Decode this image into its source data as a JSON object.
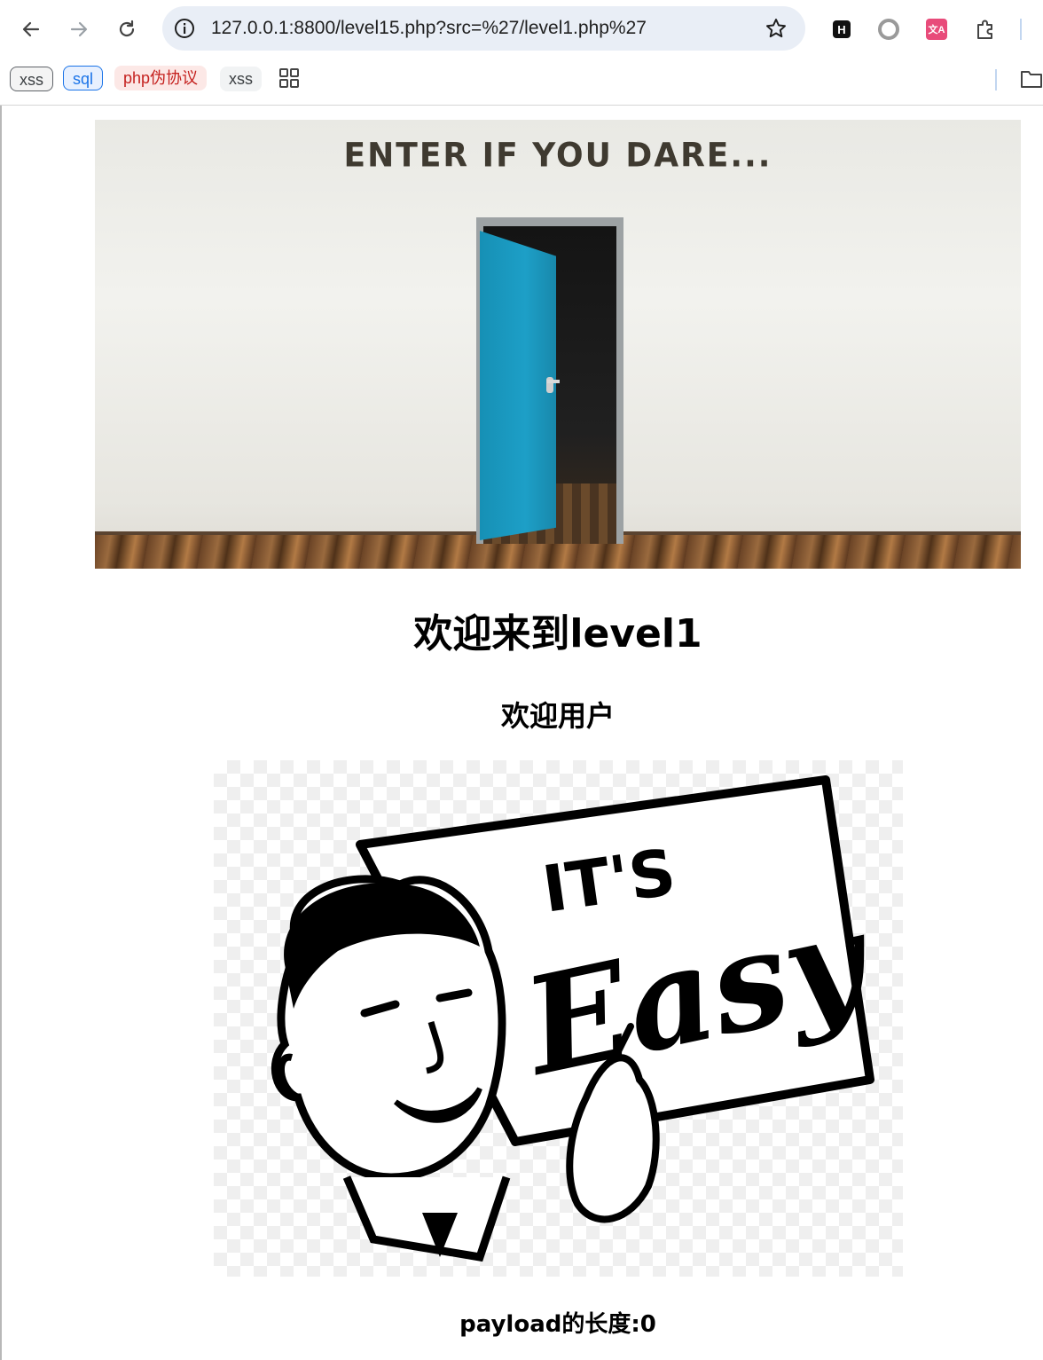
{
  "browser": {
    "url": "127.0.0.1:8800/level15.php?src=%27/level1.php%27",
    "extensions": [
      "H",
      "circle-extension",
      "translate-extension",
      "puzzle-extension"
    ],
    "bookmarks": [
      {
        "label": "xss",
        "style": "gray"
      },
      {
        "label": "sql",
        "style": "blue"
      },
      {
        "label": "php伪协议",
        "style": "pink"
      },
      {
        "label": "xss",
        "style": "plain"
      }
    ]
  },
  "page": {
    "banner_caption": "ENTER IF YOU DARE...",
    "heading": "欢迎来到level1",
    "subheading": "欢迎用户",
    "sign_top": "IT'S",
    "sign_main": "Easy",
    "payload_length": "payload的长度:0"
  },
  "colors": {
    "door": "#1d9fc7",
    "omnibox": "#e9eef6",
    "bookmark_blue": "#1a73e8",
    "bookmark_pink": "#c5221f"
  }
}
